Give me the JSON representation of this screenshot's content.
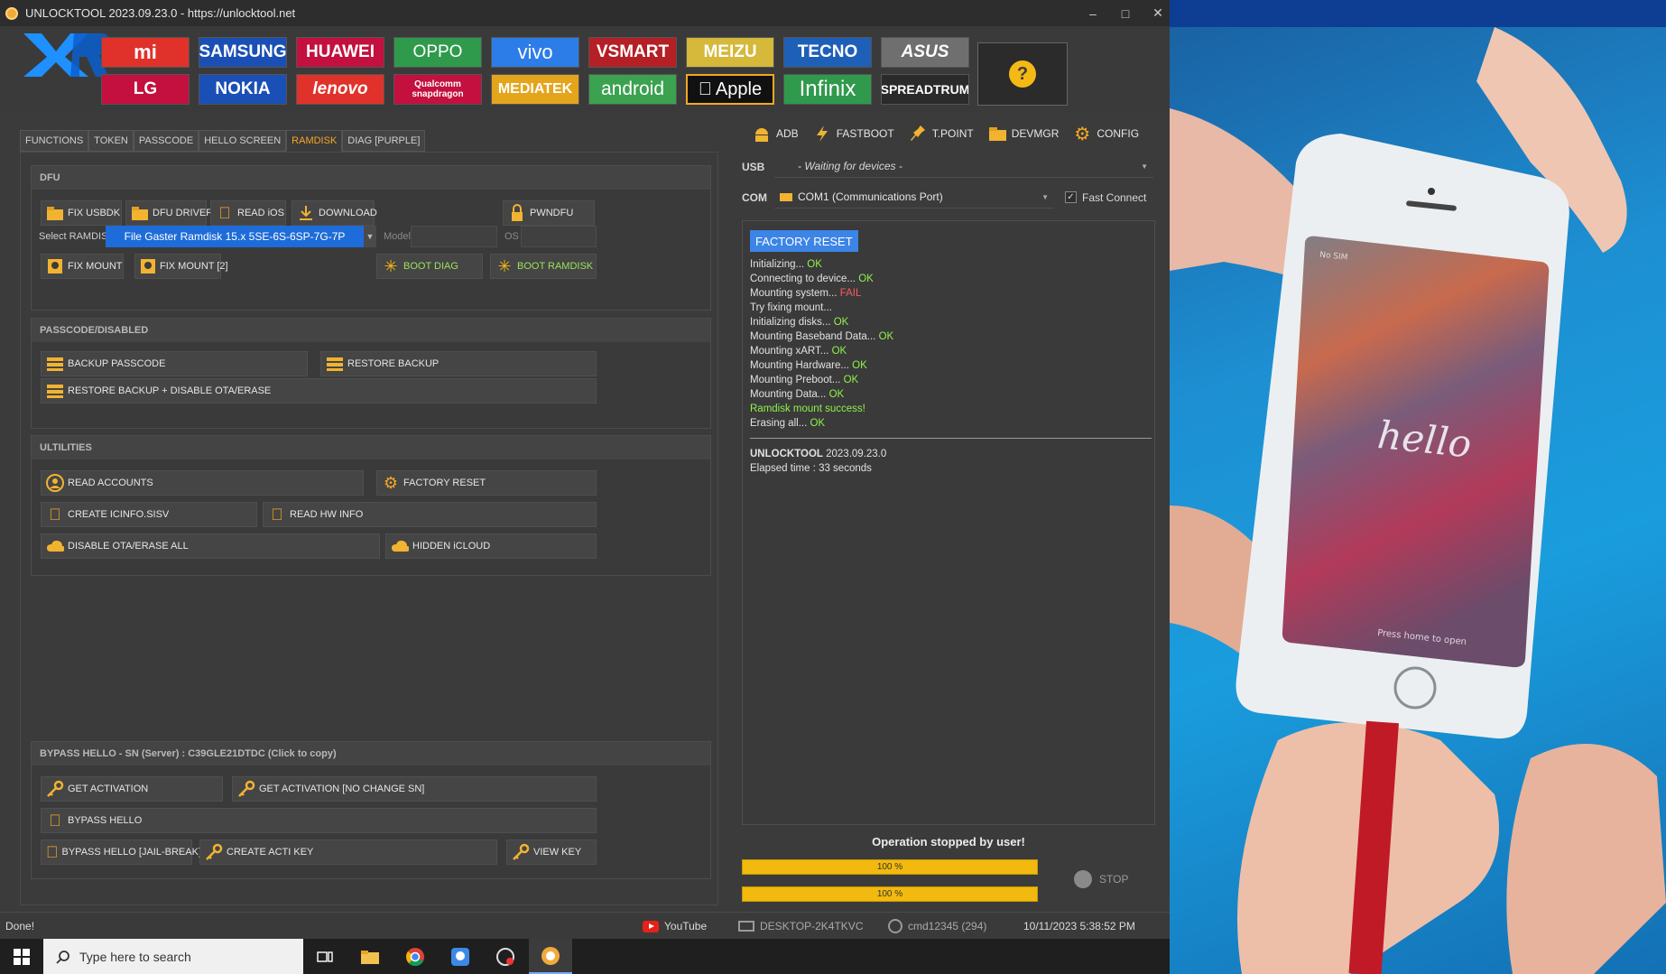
{
  "window": {
    "title": "UNLOCKTOOL 2023.09.23.0 - https://unlocktool.net",
    "min": "–",
    "max": "□",
    "close": "✕"
  },
  "brands_row1": [
    "mi",
    "SAMSUNG",
    "HUAWEI",
    "OPPO",
    "vivo",
    "VSMART",
    "MEIZU",
    "TECNO",
    "ASUS"
  ],
  "brands_row2": [
    "LG",
    "NOKIA",
    "lenovo",
    "Qualcomm snapdragon",
    "MEDIATEK",
    "android",
    "Apple",
    "Infinix",
    "SPREADTRUM"
  ],
  "help": "?",
  "tabs": [
    "FUNCTIONS",
    "TOKEN",
    "PASSCODE",
    "HELLO SCREEN",
    "RAMDISK",
    "DIAG [PURPLE]"
  ],
  "dfu": {
    "header": "DFU",
    "fix_usbdk": "FIX USBDK",
    "dfu_drivers": "DFU DRIVERS",
    "read_ios": "READ iOS",
    "download": "DOWNLOAD",
    "pwndfu": "PWNDFU",
    "select_label": "Select RAMDISK",
    "select_value": "File Gaster Ramdisk 15.x 5SE-6S-6SP-7G-7P",
    "model_label": "Model",
    "os_label": "OS",
    "fix_mount": "FIX MOUNT",
    "fix_mount2": "FIX MOUNT [2]",
    "boot_diag": "BOOT DIAG",
    "boot_ramdisk": "BOOT RAMDISK"
  },
  "passcode": {
    "header": "PASSCODE/DISABLED",
    "backup": "BACKUP PASSCODE",
    "restore": "RESTORE BACKUP",
    "restore_disable": "RESTORE BACKUP + DISABLE OTA/ERASE"
  },
  "utilities": {
    "header": "ULTILITIES",
    "read_accounts": "READ ACCOUNTS",
    "factory_reset": "FACTORY RESET",
    "create_icinfo": "CREATE ICINFO.SISV",
    "read_hw": "READ HW INFO",
    "disable_ota": "DISABLE OTA/ERASE ALL",
    "hidden_icloud": "HIDDEN iCLOUD"
  },
  "bypass": {
    "header": "BYPASS HELLO - SN (Server) : C39GLE21DTDC (Click to copy)",
    "get_activation": "GET ACTIVATION",
    "get_activation_nochange": "GET ACTIVATION [NO CHANGE SN]",
    "bypass_hello": "BYPASS HELLO",
    "bypass_jail": "BYPASS HELLO [JAIL-BREAK]",
    "create_key": "CREATE ACTI KEY",
    "view_key": "VIEW KEY"
  },
  "toolbar": {
    "adb": "ADB",
    "fastboot": "FASTBOOT",
    "tpoint": "T.POINT",
    "devmgr": "DEVMGR",
    "config": "CONFIG"
  },
  "connection": {
    "usb_label": "USB",
    "usb_value": "- Waiting for devices -",
    "com_label": "COM",
    "com_value": "COM1 (Communications Port)",
    "fast_connect": "Fast Connect",
    "fast_connect_checked": "✓"
  },
  "log": {
    "badge": "FACTORY RESET",
    "lines": [
      {
        "text": "Initializing... ",
        "status": "OK"
      },
      {
        "text": "Connecting to device... ",
        "status": "OK"
      },
      {
        "text": "Mounting system... ",
        "status": "FAIL"
      },
      {
        "text": "Try fixing mount...",
        "status": ""
      },
      {
        "text": "Initializing disks... ",
        "status": "OK"
      },
      {
        "text": "Mounting Baseband Data... ",
        "status": "OK"
      },
      {
        "text": "Mounting xART... ",
        "status": "OK"
      },
      {
        "text": "Mounting Hardware... ",
        "status": "OK"
      },
      {
        "text": "Mounting Preboot... ",
        "status": "OK"
      },
      {
        "text": "Mounting Data... ",
        "status": "OK"
      },
      {
        "text": "Ramdisk mount success!",
        "status": "SUCCESS"
      },
      {
        "text": "Erasing all... ",
        "status": "OK"
      }
    ],
    "tool_name": "UNLOCKTOOL",
    "tool_version": "2023.09.23.0",
    "elapsed": "Elapsed time : 33 seconds"
  },
  "operation": {
    "message": "Operation stopped by user!",
    "progress1": "100 %",
    "progress2": "100 %",
    "progress1_value": 100,
    "progress2_value": 100,
    "stop": "STOP"
  },
  "statusbar": {
    "status": "Done!",
    "youtube": "YouTube",
    "pc": "DESKTOP-2K4TKVC",
    "user": "cmd12345 (294)",
    "datetime": "10/11/2023 5:38:52 PM"
  },
  "taskbar": {
    "search_placeholder": "Type here to search"
  },
  "phone_screen": {
    "greeting": "hello",
    "carrier": "No SIM",
    "press_home": "Press home to open"
  },
  "colors": {
    "accent": "#f5a623",
    "ok": "#8ff24a",
    "fail": "#ff5a5a",
    "select_blue": "#1e6cd9",
    "progress": "#f2b90f"
  }
}
